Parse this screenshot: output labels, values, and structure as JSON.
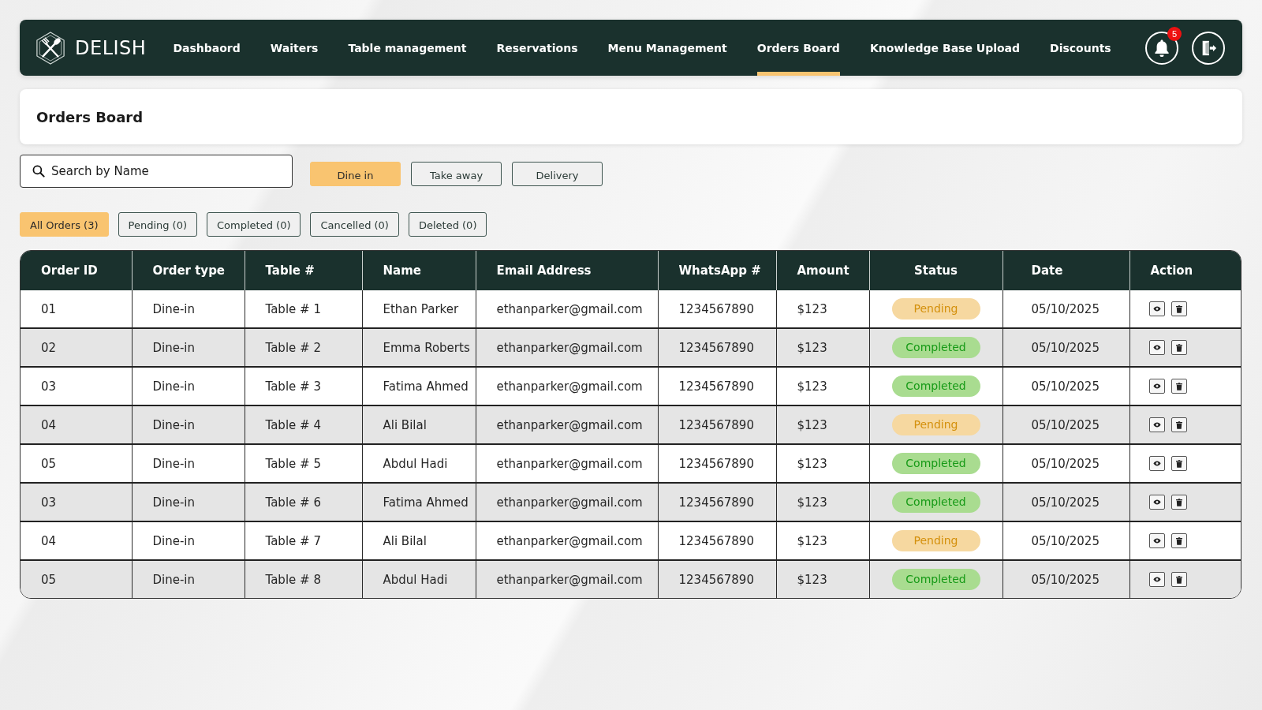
{
  "navbar": {
    "brand": "DELISH",
    "items": [
      {
        "label": "Dashbaord",
        "selected": false
      },
      {
        "label": "Waiters",
        "selected": false
      },
      {
        "label": "Table management",
        "selected": false
      },
      {
        "label": "Reservations",
        "selected": false
      },
      {
        "label": "Menu Management",
        "selected": false
      },
      {
        "label": "Orders Board",
        "selected": true
      },
      {
        "label": "Knowledge Base Upload",
        "selected": false
      },
      {
        "label": "Discounts",
        "selected": false
      }
    ],
    "notifications": {
      "count": "5"
    }
  },
  "page_header": {
    "title": "Orders Board"
  },
  "search": {
    "placeholder": "Search by Name"
  },
  "order_type_filters": [
    {
      "label": "Dine in",
      "selected": true
    },
    {
      "label": "Take away",
      "selected": false
    },
    {
      "label": "Delivery",
      "selected": false
    }
  ],
  "status_filters": [
    {
      "label": "All Orders (3)",
      "selected": true
    },
    {
      "label": "Pending (0)",
      "selected": false
    },
    {
      "label": "Completed (0)",
      "selected": false
    },
    {
      "label": "Cancelled (0)",
      "selected": false
    },
    {
      "label": "Deleted (0)",
      "selected": false
    }
  ],
  "table": {
    "columns": [
      "Order ID",
      "Order type",
      "Table #",
      "Name",
      "Email Address",
      "WhatsApp #",
      "Amount",
      "Status",
      "Date",
      "Action"
    ],
    "rows": [
      {
        "order_id": "01",
        "order_type": "Dine-in",
        "table": "Table # 1",
        "name": "Ethan Parker",
        "email": "ethanparker@gmail.com",
        "whatsapp": "1234567890",
        "amount": "$123",
        "status": {
          "label": "Pending",
          "kind": "pending"
        },
        "date": "05/10/2025"
      },
      {
        "order_id": "02",
        "order_type": "Dine-in",
        "table": "Table # 2",
        "name": "Emma Roberts",
        "email": "ethanparker@gmail.com",
        "whatsapp": "1234567890",
        "amount": "$123",
        "status": {
          "label": "Completed",
          "kind": "completed"
        },
        "date": "05/10/2025"
      },
      {
        "order_id": "03",
        "order_type": "Dine-in",
        "table": "Table # 3",
        "name": "Fatima Ahmed",
        "email": "ethanparker@gmail.com",
        "whatsapp": "1234567890",
        "amount": "$123",
        "status": {
          "label": "Completed",
          "kind": "completed"
        },
        "date": "05/10/2025"
      },
      {
        "order_id": "04",
        "order_type": "Dine-in",
        "table": "Table # 4",
        "name": "Ali Bilal",
        "email": "ethanparker@gmail.com",
        "whatsapp": "1234567890",
        "amount": "$123",
        "status": {
          "label": "Pending",
          "kind": "pending"
        },
        "date": "05/10/2025"
      },
      {
        "order_id": "05",
        "order_type": "Dine-in",
        "table": "Table # 5",
        "name": "Abdul Hadi",
        "email": "ethanparker@gmail.com",
        "whatsapp": "1234567890",
        "amount": "$123",
        "status": {
          "label": "Completed",
          "kind": "completed"
        },
        "date": "05/10/2025"
      },
      {
        "order_id": "03",
        "order_type": "Dine-in",
        "table": "Table # 6",
        "name": "Fatima Ahmed",
        "email": "ethanparker@gmail.com",
        "whatsapp": "1234567890",
        "amount": "$123",
        "status": {
          "label": "Completed",
          "kind": "completed"
        },
        "date": "05/10/2025"
      },
      {
        "order_id": "04",
        "order_type": "Dine-in",
        "table": "Table # 7",
        "name": "Ali Bilal",
        "email": "ethanparker@gmail.com",
        "whatsapp": "1234567890",
        "amount": "$123",
        "status": {
          "label": "Pending",
          "kind": "pending"
        },
        "date": "05/10/2025"
      },
      {
        "order_id": "05",
        "order_type": "Dine-in",
        "table": "Table # 8",
        "name": "Abdul Hadi",
        "email": "ethanparker@gmail.com",
        "whatsapp": "1234567890",
        "amount": "$123",
        "status": {
          "label": "Completed",
          "kind": "completed"
        },
        "date": "05/10/2025"
      }
    ]
  }
}
